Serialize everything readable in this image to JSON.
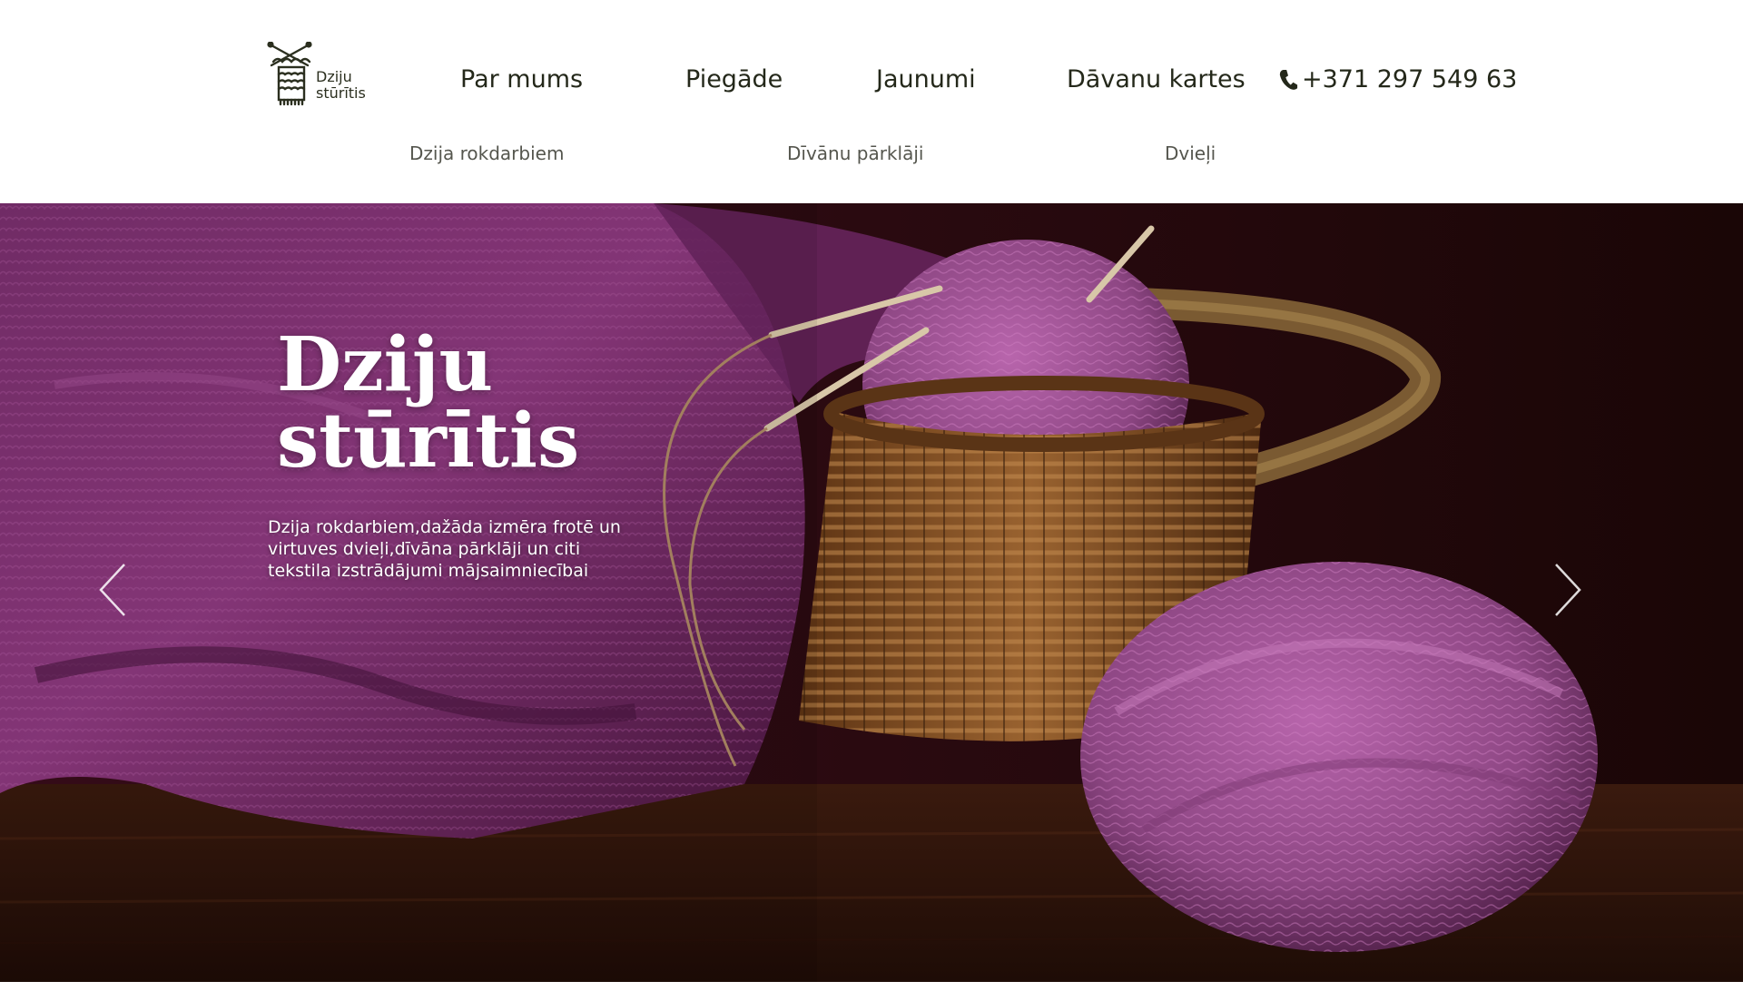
{
  "brand": {
    "name_line1": "Dziju",
    "name_line2": "stūrītis"
  },
  "nav": {
    "items": [
      {
        "label": "Par mums"
      },
      {
        "label": "Piegāde"
      },
      {
        "label": "Jaunumi"
      },
      {
        "label": "Dāvanu kartes"
      }
    ],
    "phone": "+371 297 549 63"
  },
  "subnav": {
    "items": [
      {
        "label": "Dzija rokdarbiem"
      },
      {
        "label": "Dīvānu pārklāji"
      },
      {
        "label": "Dvieļi"
      }
    ]
  },
  "hero": {
    "title_line1": "Dziju",
    "title_line2": "stūrītis",
    "description": "Dzija rokdarbiem,dažāda izmēra frotē un virtuves dvieļi,dīvāna pārklāji un citi tekstila izstrādājumi mājsaimniecībai",
    "prev_icon": "chevron-left-icon",
    "next_icon": "chevron-right-icon"
  },
  "colors": {
    "text_dark": "#24281a",
    "subnav_text": "#55564e",
    "hero_text": "#ffffff",
    "yarn_purple": "#9c4a95",
    "basket_brown": "#8a5626",
    "wood_dark": "#3a1a0e"
  }
}
